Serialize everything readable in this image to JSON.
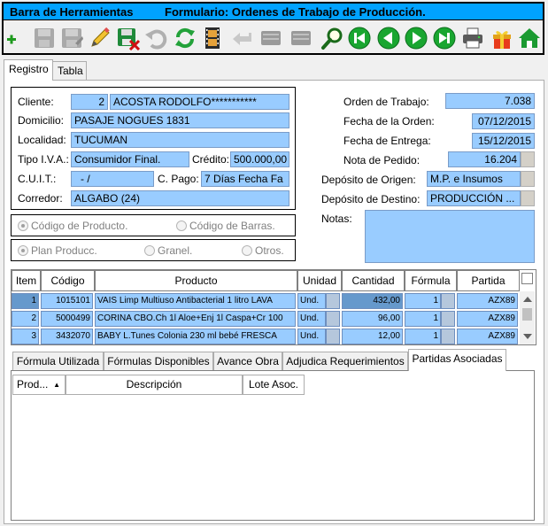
{
  "toolbar": {
    "title": "Barra de Herramientas",
    "form_title": "Formulario: Ordenes de Trabajo de Producción.",
    "icons": [
      "add-icon",
      "save-disabled-icon",
      "save-as-disabled-icon",
      "edit-icon",
      "save-exit-icon",
      "undo-disabled-icon",
      "refresh-icon",
      "film-icon",
      "return-disabled-icon",
      "blank-disabled-icon",
      "blank-disabled-icon",
      "search-icon",
      "first-icon",
      "previous-icon",
      "next-icon",
      "last-icon",
      "print-icon",
      "gift-icon",
      "home-icon"
    ]
  },
  "tabs": [
    "Registro",
    "Tabla"
  ],
  "client": {
    "cliente_label": "Cliente:",
    "cliente_code": "2",
    "cliente_name": "ACOSTA RODOLFO***********",
    "domicilio_label": "Domicilio:",
    "domicilio": "PASAJE NOGUES 1831",
    "localidad_label": "Localidad:",
    "localidad": "TUCUMAN",
    "iva_label": "Tipo I.V.A.:",
    "iva": "Consumidor Final.",
    "credito_label": "Crédito:",
    "credito": "500.000,00",
    "cuit_label": "C.U.I.T.:",
    "cuit": "-        /",
    "cpago_label": "C. Pago:",
    "cpago": "7 Días Fecha Fa",
    "corredor_label": "Corredor:",
    "corredor": "ALGABO (24)"
  },
  "order": {
    "orden_label": "Orden de Trabajo:",
    "orden": "7.038",
    "fecha_orden_label": "Fecha de la Orden:",
    "fecha_orden": "07/12/2015",
    "fecha_entrega_label": "Fecha de Entrega:",
    "fecha_entrega": "15/12/2015",
    "nota_label": "Nota de Pedido:",
    "nota": "16.204",
    "dep_origen_label": "Depósito de Origen:",
    "dep_origen": "M.P. e Insumos",
    "dep_destino_label": "Depósito de Destino:",
    "dep_destino": "PRODUCCIÓN ...",
    "notas_label": "Notas:"
  },
  "radios1": [
    "Código de Producto.",
    "Código de Barras."
  ],
  "radios2": [
    "Plan Producc.",
    "Granel.",
    "Otros."
  ],
  "grid": {
    "headers": [
      "Item",
      "Código",
      "Producto",
      "Unidad",
      "Cantidad",
      "Fórmula",
      "Partida"
    ],
    "rows": [
      {
        "item": "1",
        "codigo": "1015101",
        "producto": "VAIS Limp Multiuso Antibacterial 1 litro LAVA",
        "unidad": "Und.",
        "cantidad": "432,00",
        "formula": "1",
        "partida": "AZX89"
      },
      {
        "item": "2",
        "codigo": "5000499",
        "producto": "CORINA CBO.Ch 1l  Aloe+Enj 1l Caspa+Cr 100",
        "unidad": "Und.",
        "cantidad": "96,00",
        "formula": "1",
        "partida": "AZX89"
      },
      {
        "item": "3",
        "codigo": "3432070",
        "producto": "BABY L.Tunes Colonia 230 ml bebé FRESCA",
        "unidad": "Und.",
        "cantidad": "12,00",
        "formula": "1",
        "partida": "AZX89"
      }
    ]
  },
  "subtabs": [
    "Fórmula Utilizada",
    "Fórmulas Disponibles",
    "Avance Obra",
    "Adjudica Requerimientos",
    "Partidas Asociadas"
  ],
  "subgrid": {
    "headers": [
      "Prod...",
      "Descripción",
      "Lote Asoc."
    ]
  }
}
